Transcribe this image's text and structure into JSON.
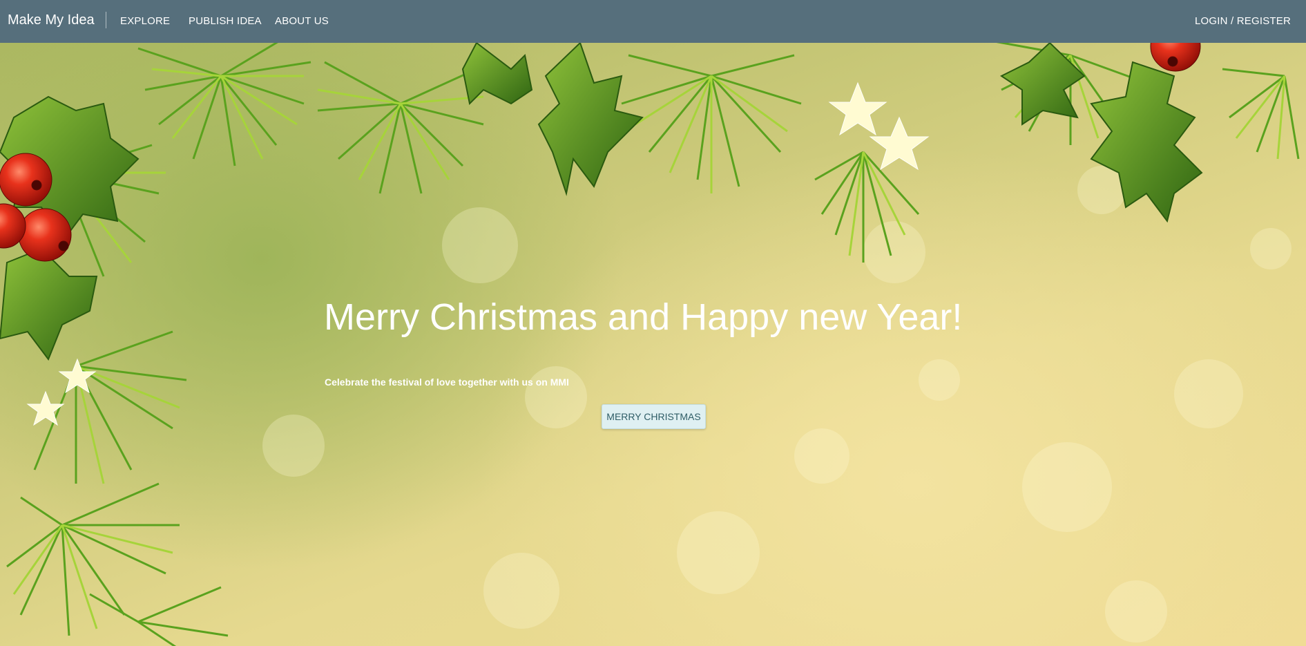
{
  "navbar": {
    "brand": "Make My Idea",
    "links": [
      "EXPLORE",
      "PUBLISH IDEA",
      "ABOUT US"
    ],
    "login": "LOGIN / REGISTER"
  },
  "hero": {
    "title": "Merry Christmas and Happy new Year!",
    "subtitle": "Celebrate the festival of love together with us on MMI",
    "button_label": "MERRY CHRISTMAS"
  },
  "colors": {
    "navbar_bg": "#566f7c",
    "button_bg": "#dff0f2",
    "button_text": "#2f5d66",
    "berry_red": "#d61f12",
    "pine_green": "#4f8f1a",
    "holly_green": "#3f7a1a",
    "background_gold": "#f0dc95"
  },
  "decor_icons": [
    "pine-branch-icon",
    "holly-leaf-icon",
    "red-berry-icon",
    "star-icon"
  ]
}
